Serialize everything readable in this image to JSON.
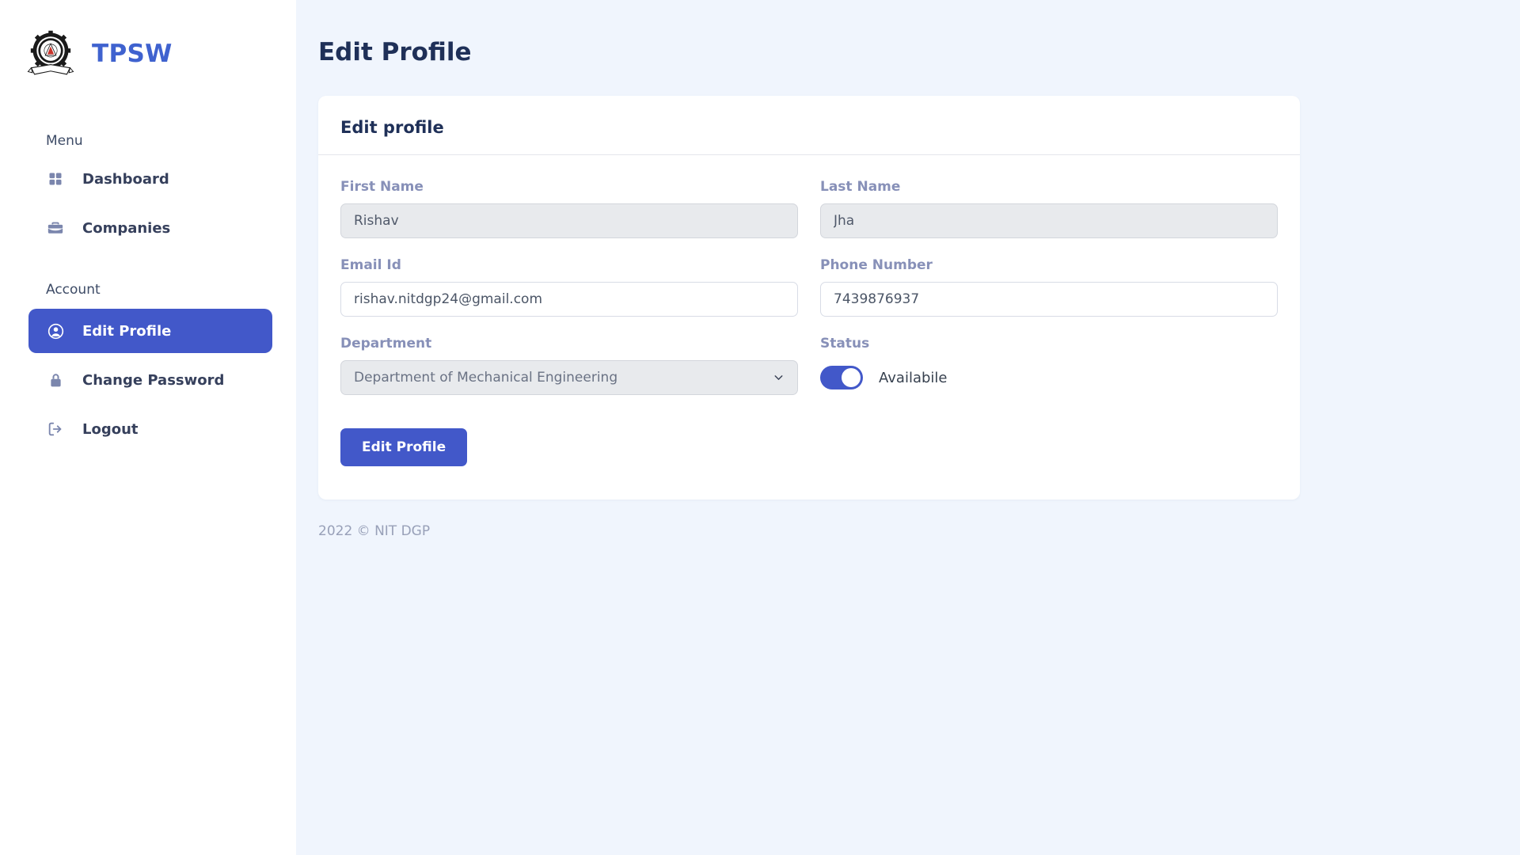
{
  "brand": {
    "name": "TPSW",
    "logo_icon": "nit-durgapur-emblem-icon",
    "accent_color": "#3f62cf"
  },
  "sidebar": {
    "sections": [
      {
        "label": "Menu",
        "items": [
          {
            "label": "Dashboard",
            "icon": "grid-icon",
            "active": false
          },
          {
            "label": "Companies",
            "icon": "briefcase-icon",
            "active": false
          }
        ]
      },
      {
        "label": "Account",
        "items": [
          {
            "label": "Edit Profile",
            "icon": "user-circle-icon",
            "active": true
          },
          {
            "label": "Change Password",
            "icon": "lock-icon",
            "active": false
          },
          {
            "label": "Logout",
            "icon": "logout-icon",
            "active": false
          }
        ]
      }
    ],
    "active_color": "#4258c9"
  },
  "header": {
    "page_title": "Edit Profile"
  },
  "card": {
    "title": "Edit profile",
    "fields": {
      "first_name": {
        "label": "First Name",
        "value": "Rishav",
        "placeholder": "First Name",
        "disabled": true
      },
      "last_name": {
        "label": "Last Name",
        "value": "Jha",
        "placeholder": "Last Name",
        "disabled": true
      },
      "email": {
        "label": "Email Id",
        "value": "rishav.nitdgp24@gmail.com",
        "placeholder": "Email Id",
        "disabled": false
      },
      "phone": {
        "label": "Phone Number",
        "value": "7439876937",
        "placeholder": "Phone Number",
        "disabled": false
      },
      "department": {
        "label": "Department",
        "value": "Department of Mechanical Engineering",
        "options": [
          "Department of Mechanical Engineering"
        ],
        "chevron_icon": "chevron-down-icon",
        "disabled": true
      },
      "status": {
        "label": "Status",
        "toggle_on": true,
        "toggle_label": "Availabile"
      }
    },
    "submit_label": "Edit Profile"
  },
  "footer": {
    "text": "2022 © NIT DGP"
  }
}
